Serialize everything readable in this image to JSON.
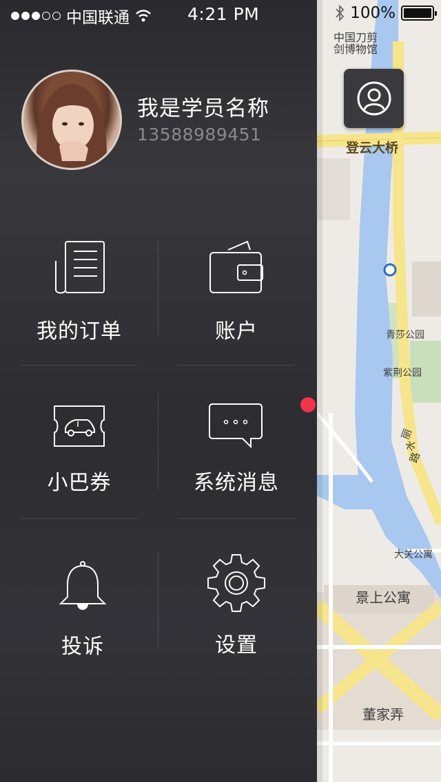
{
  "status_bar": {
    "carrier": "中国联通",
    "time": "4:21 PM",
    "battery": "100%",
    "signal_icon": "signal-dots-icon",
    "wifi_icon": "wifi-icon",
    "bluetooth_icon": "bluetooth-icon"
  },
  "user": {
    "name": "我是学员名称",
    "phone": "13588989451",
    "avatar_icon": "user-avatar"
  },
  "menu": [
    {
      "label": "我的订单",
      "icon": "orders-document-icon"
    },
    {
      "label": "账户",
      "icon": "wallet-icon"
    },
    {
      "label": "小巴券",
      "icon": "bus-ticket-icon"
    },
    {
      "label": "系统消息",
      "icon": "message-bubble-icon",
      "badge": true
    },
    {
      "label": "投诉",
      "icon": "bell-icon"
    },
    {
      "label": "设置",
      "icon": "gear-icon"
    }
  ],
  "map": {
    "labels": [
      "中国刀剪",
      "剑博物馆",
      "登云大桥",
      "青莎公园",
      "紫荆公园",
      "丽",
      "水",
      "路",
      "大关公寓",
      "景上公寓",
      "董家弄"
    ],
    "profile_button_icon": "profile-icon"
  },
  "colors": {
    "badge": "#f2334a",
    "drawer_bg": "#2d2d31",
    "river": "#a8c8f0",
    "road_yellow": "#f6e58c",
    "map_bg": "#eeebe6"
  }
}
